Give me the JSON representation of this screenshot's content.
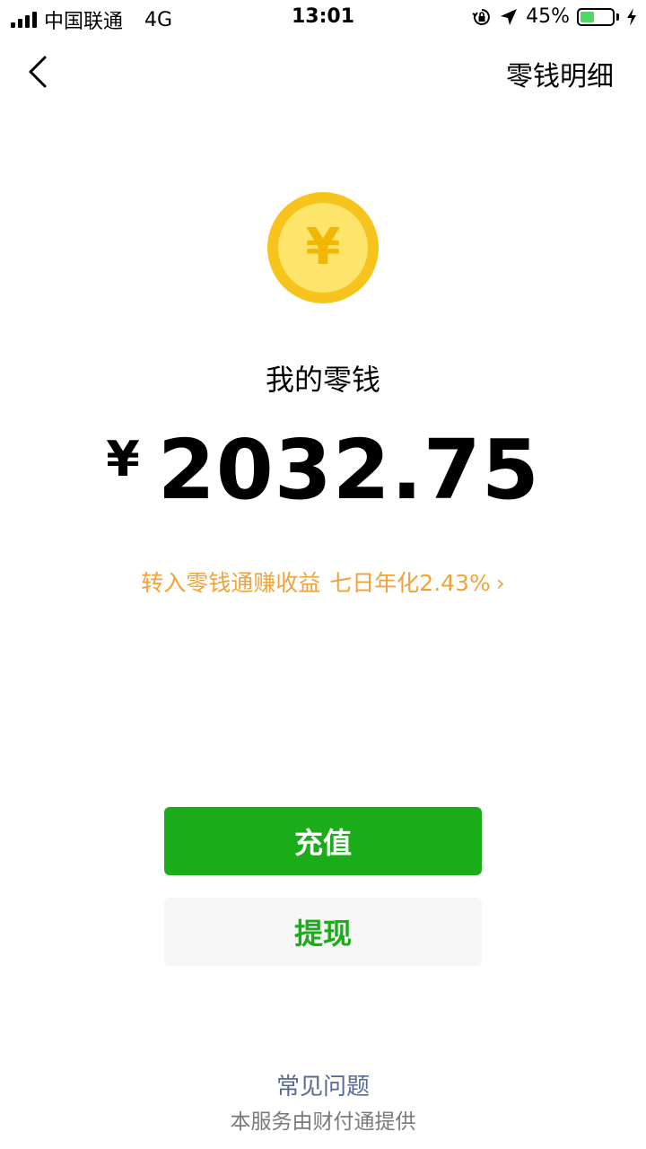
{
  "status_bar": {
    "carrier": "中国联通",
    "network": "4G",
    "time": "13:01",
    "battery_text": "45%",
    "battery_level": 0.45,
    "battery_color": "#4cd964"
  },
  "nav": {
    "back_icon": "chevron-left-icon",
    "title_right": "零钱明细"
  },
  "wallet": {
    "coin_icon": "yuan-coin-icon",
    "coin_symbol": "¥",
    "label": "我的零钱",
    "currency": "¥",
    "amount": "2032.75"
  },
  "promo": {
    "text": "转入零钱通赚收益",
    "rate_text": "七日年化2.43%",
    "chevron": "›",
    "color": "#f1a33b"
  },
  "buttons": {
    "recharge": "充值",
    "withdraw": "提现",
    "primary_color": "#1aad19"
  },
  "footer": {
    "faq": "常见问题",
    "provider": "本服务由财付通提供"
  }
}
